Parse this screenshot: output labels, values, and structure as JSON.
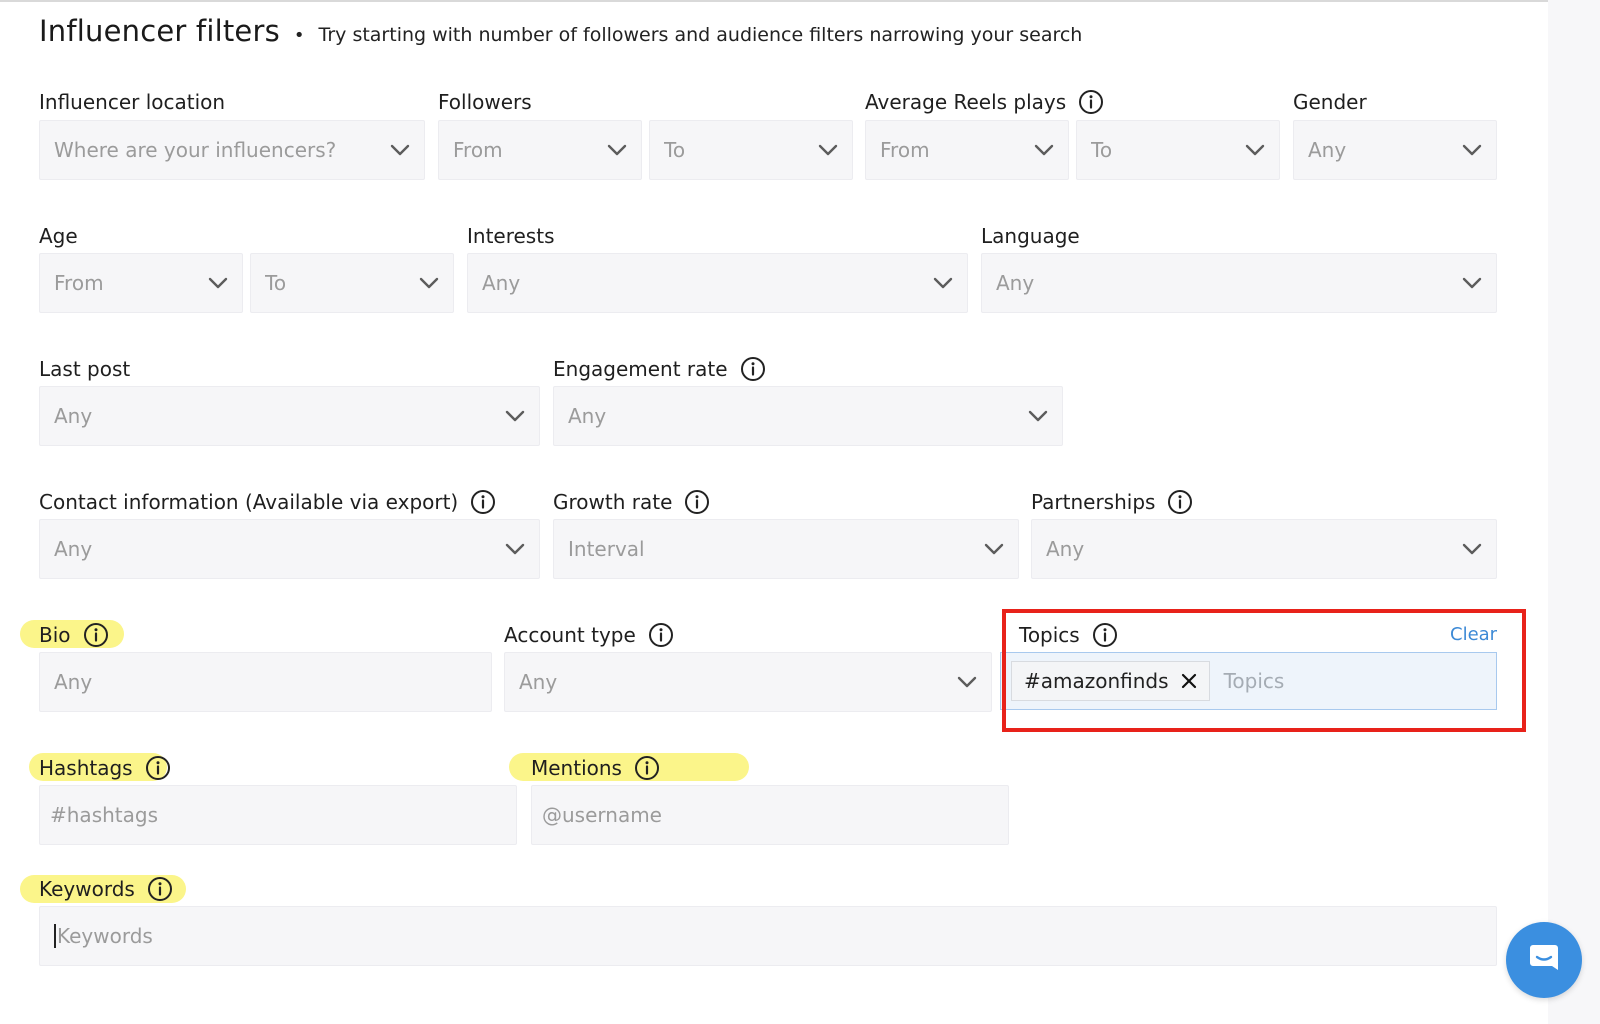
{
  "header": {
    "title": "Influencer filters",
    "separator": "•",
    "subtitle": "Try starting with number of followers and audience filters narrowing your search"
  },
  "filters": {
    "influencer_location": {
      "label": "Influencer location",
      "value": "Where are your influencers?"
    },
    "followers": {
      "label": "Followers",
      "from": "From",
      "to": "To"
    },
    "avg_reels_plays": {
      "label": "Average Reels plays",
      "from": "From",
      "to": "To"
    },
    "gender": {
      "label": "Gender",
      "value": "Any"
    },
    "age": {
      "label": "Age",
      "from": "From",
      "to": "To"
    },
    "interests": {
      "label": "Interests",
      "value": "Any"
    },
    "language": {
      "label": "Language",
      "value": "Any"
    },
    "last_post": {
      "label": "Last post",
      "value": "Any"
    },
    "engagement_rate": {
      "label": "Engagement rate",
      "value": "Any"
    },
    "contact_info": {
      "label": "Contact information (Available via export)",
      "value": "Any"
    },
    "growth_rate": {
      "label": "Growth rate",
      "value": "Interval"
    },
    "partnerships": {
      "label": "Partnerships",
      "value": "Any"
    },
    "bio": {
      "label": "Bio",
      "placeholder": "Any"
    },
    "account_type": {
      "label": "Account type",
      "value": "Any"
    },
    "topics": {
      "label": "Topics",
      "clear": "Clear",
      "chip": "#amazonfinds",
      "placeholder": "Topics"
    },
    "hashtags": {
      "label": "Hashtags",
      "placeholder": "#hashtags"
    },
    "mentions": {
      "label": "Mentions",
      "placeholder": "@username"
    },
    "keywords": {
      "label": "Keywords",
      "placeholder": "Keywords"
    }
  },
  "colors": {
    "highlight": "#fbf58a",
    "annotation_box": "#e8221a",
    "link": "#3d8ad6",
    "chat_button": "#3b8fe0"
  },
  "icons": [
    "info-icon",
    "chevron-down-icon",
    "close-icon",
    "chat-icon"
  ]
}
